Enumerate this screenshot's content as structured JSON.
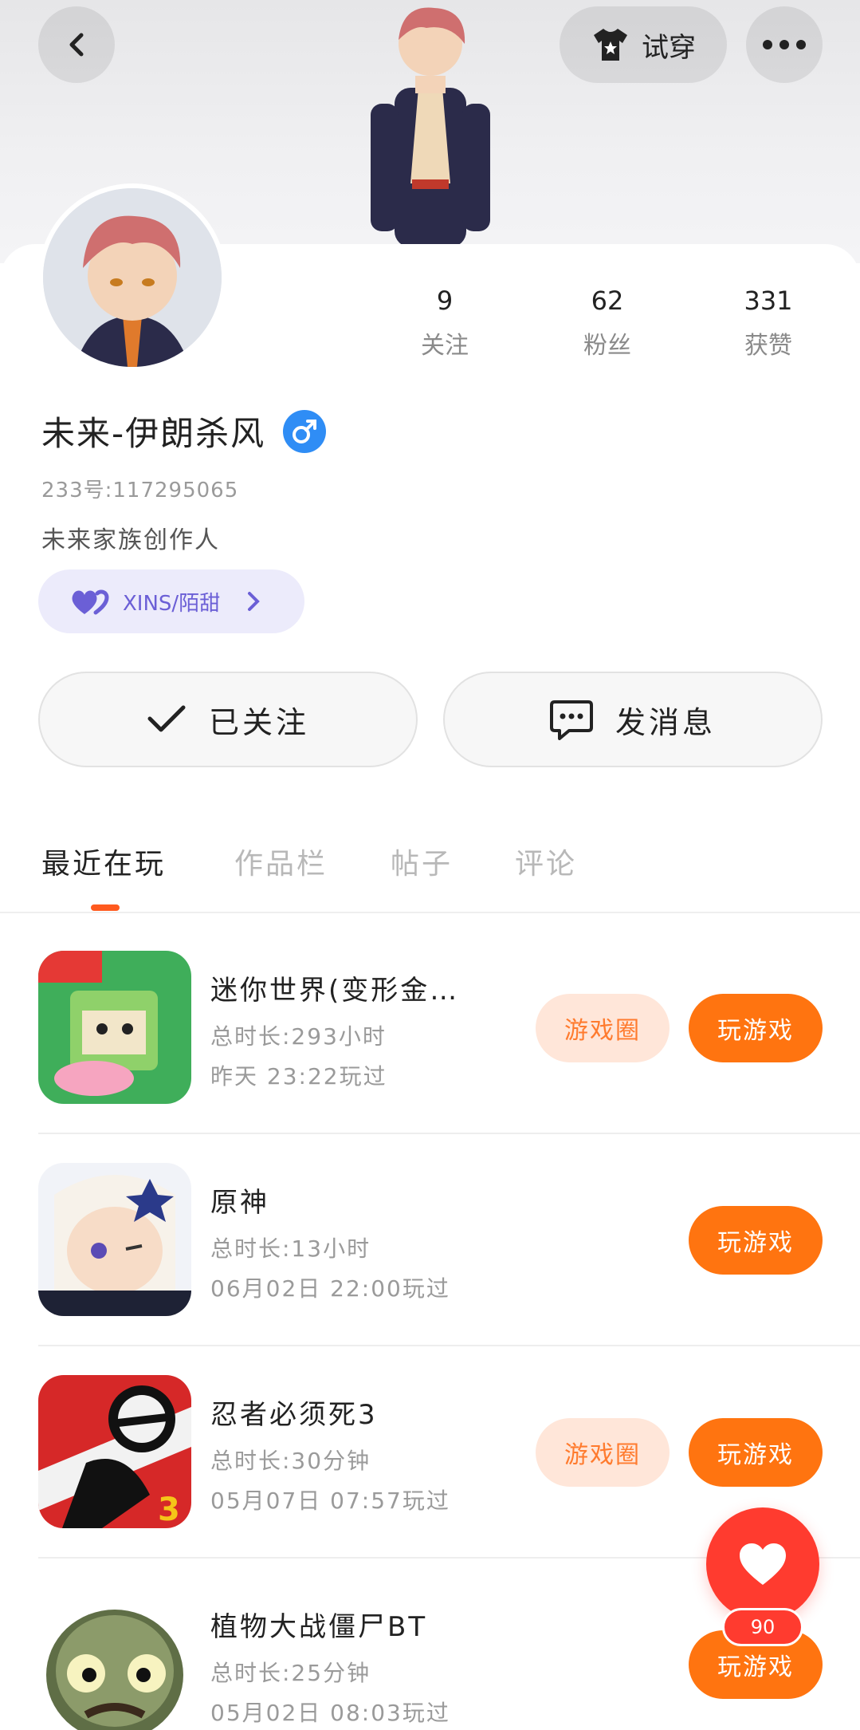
{
  "header": {
    "try_on_label": "试穿",
    "back_icon": "chevron-left-icon",
    "more_icon": "more-dots-icon",
    "try_on_icon": "shirt-icon"
  },
  "profile": {
    "stats": [
      {
        "value": "9",
        "label": "关注"
      },
      {
        "value": "62",
        "label": "粉丝"
      },
      {
        "value": "331",
        "label": "获赞"
      }
    ],
    "nickname": "未来-伊朗杀风",
    "gender_icon": "male-icon",
    "uid": "233号:117295065",
    "bio": "未来家族创作人",
    "family": {
      "name": "XINS/陌甜",
      "icon": "heart-pair-icon"
    }
  },
  "actions": {
    "follow_label": "已关注",
    "message_label": "发消息"
  },
  "tabs": [
    "最近在玩",
    "作品栏",
    "帖子",
    "评论"
  ],
  "games": [
    {
      "title": "迷你世界(变形金…",
      "total": "总时长:293小时",
      "last": "昨天 23:22玩过",
      "circle": "游戏圈",
      "play": "玩游戏"
    },
    {
      "title": "原神",
      "total": "总时长:13小时",
      "last": "06月02日 22:00玩过",
      "play": "玩游戏"
    },
    {
      "title": "忍者必须死3",
      "total": "总时长:30分钟",
      "last": "05月07日 07:57玩过",
      "circle": "游戏圈",
      "play": "玩游戏"
    },
    {
      "title": "植物大战僵尸BT",
      "total": "总时长:25分钟",
      "last": "05月02日 08:03玩过",
      "play": "玩游戏"
    }
  ],
  "like": {
    "count": "90",
    "icon": "heart-icon"
  },
  "colors": {
    "accent": "#ff7410",
    "like": "#ff3b2f",
    "gender": "#2f8df5",
    "family_bg": "#ecebfb"
  }
}
